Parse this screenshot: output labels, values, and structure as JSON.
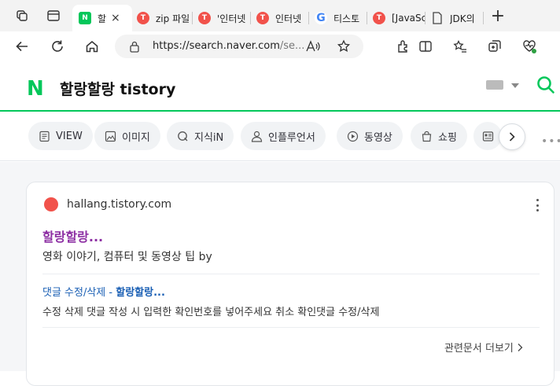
{
  "browser": {
    "tabs": [
      {
        "label": "할",
        "favicon": "naver",
        "glyph": "N",
        "active": true
      },
      {
        "label": "zip 파일",
        "favicon": "tistory",
        "glyph": "T"
      },
      {
        "label": "'인터넷",
        "favicon": "tistory",
        "glyph": "T"
      },
      {
        "label": "인터넷",
        "favicon": "tistory",
        "glyph": "T"
      },
      {
        "label": "티스토",
        "favicon": "google",
        "glyph": "G"
      },
      {
        "label": "[JavaSc",
        "favicon": "tistory",
        "glyph": "T"
      },
      {
        "label": "JDK의",
        "favicon": "doc",
        "glyph": ""
      }
    ],
    "close_tab_glyph": "×",
    "new_tab_glyph": "+",
    "address": {
      "host": "https://search.naver.com",
      "rest": "/se..."
    }
  },
  "site": {
    "logo": "N",
    "query": "할랑할랑 tistory"
  },
  "chips": [
    {
      "label": "VIEW",
      "icon": "document-icon"
    },
    {
      "label": "이미지",
      "icon": "image-icon"
    },
    {
      "label": "지식iN",
      "icon": "q-icon"
    },
    {
      "label": "인플루언서",
      "icon": "person-icon"
    },
    {
      "label": "동영상",
      "icon": "play-icon"
    },
    {
      "label": "쇼핑",
      "icon": "bag-icon"
    }
  ],
  "more_glyph": "•••",
  "result": {
    "site_url": "hallang.tistory.com",
    "title": "할랑할랑...",
    "description": "영화 이야기, 컴퓨터 및 동영상 팁 by",
    "sub_link_prefix": "댓글 수정/삭제 - ",
    "sub_link_bold": "할랑할랑...",
    "sub_description": "수정 삭제 댓글 작성 시 입력한 확인번호를 넣어주세요 취소 확인댓글 수정/삭제",
    "related_label": "관련문서 더보기"
  },
  "colors": {
    "naver_green": "#03c75a",
    "title_purple": "#8d2fa3",
    "link_blue": "#1a5fb4"
  }
}
